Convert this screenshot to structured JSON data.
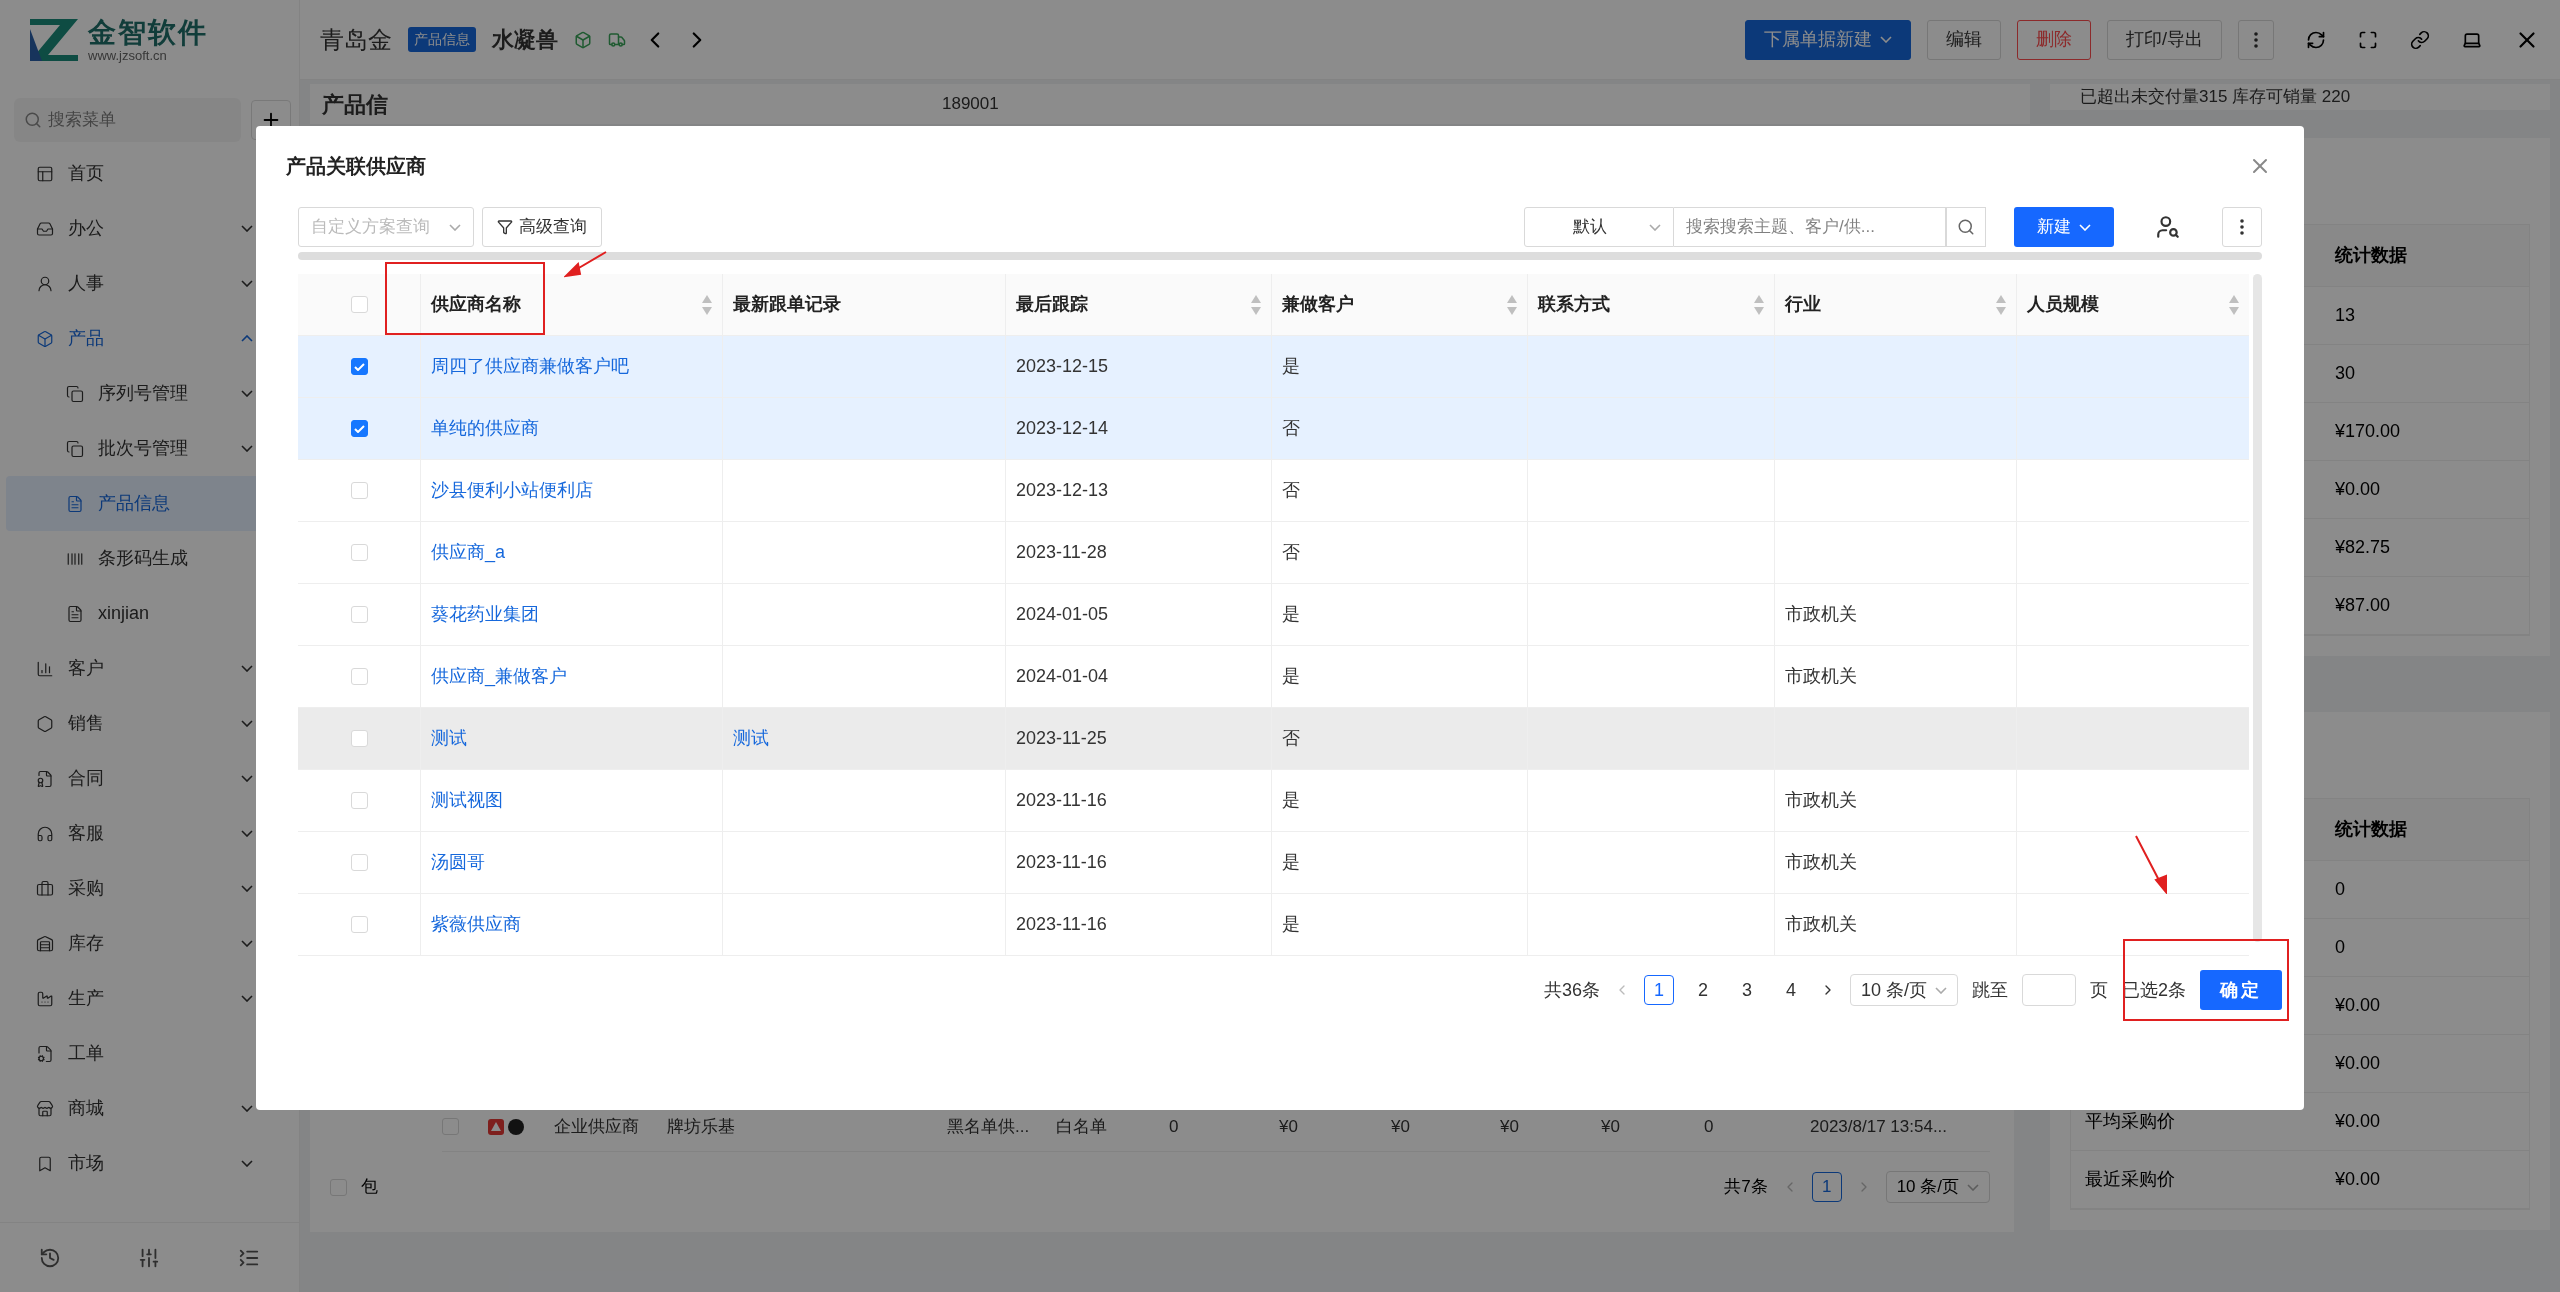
{
  "sidebar": {
    "logo_title": "金智软件",
    "logo_url": "www.jzsoft.cn",
    "search_placeholder": "搜索菜单",
    "items": [
      {
        "label": "首页",
        "kind": "link",
        "selected": false
      },
      {
        "label": "办公",
        "kind": "group",
        "expanded": false,
        "selected": false
      },
      {
        "label": "人事",
        "kind": "group",
        "expanded": false,
        "selected": false
      },
      {
        "label": "产品",
        "kind": "group",
        "expanded": true,
        "selected": false,
        "active": true,
        "children": [
          {
            "label": "序列号管理",
            "kind": "group",
            "expanded": false,
            "selected": false
          },
          {
            "label": "批次号管理",
            "kind": "group",
            "expanded": false,
            "selected": false
          },
          {
            "label": "产品信息",
            "kind": "link",
            "selected": true
          },
          {
            "label": "条形码生成",
            "kind": "link",
            "selected": false
          },
          {
            "label": "xinjian",
            "kind": "link",
            "selected": false
          }
        ]
      },
      {
        "label": "客户",
        "kind": "group",
        "expanded": false,
        "selected": false
      },
      {
        "label": "销售",
        "kind": "group",
        "expanded": false,
        "selected": false
      },
      {
        "label": "合同",
        "kind": "group",
        "expanded": false,
        "selected": false
      },
      {
        "label": "客服",
        "kind": "group",
        "expanded": false,
        "selected": false
      },
      {
        "label": "采购",
        "kind": "group",
        "expanded": false,
        "selected": false
      },
      {
        "label": "库存",
        "kind": "group",
        "expanded": false,
        "selected": false
      },
      {
        "label": "生产",
        "kind": "group",
        "expanded": false,
        "selected": false
      },
      {
        "label": "工单",
        "kind": "link",
        "selected": false
      },
      {
        "label": "商城",
        "kind": "group",
        "expanded": false,
        "selected": false
      },
      {
        "label": "市场",
        "kind": "group",
        "expanded": false,
        "selected": false
      }
    ]
  },
  "header": {
    "breadcrumb": "青岛金",
    "tag": "产品信息",
    "title": "水凝兽",
    "buttons": [
      {
        "label": "下属单据新建",
        "kind": "primary"
      },
      {
        "label": "编辑",
        "kind": "default"
      },
      {
        "label": "删除",
        "kind": "danger"
      },
      {
        "label": "打印/导出",
        "kind": "default"
      }
    ]
  },
  "main": {
    "section_title": "产品信",
    "field_value": "189001",
    "bottom_row": {
      "checked": false,
      "cells": [
        "企业供应商",
        "牌坊乐基",
        "黑名单供...",
        "白名单",
        "0",
        "¥0",
        "¥0",
        "¥0",
        "¥0",
        "0",
        "2023/8/17 13:54..."
      ]
    },
    "pagination": {
      "total": "共7条",
      "pages": [
        {
          "label": "1",
          "selected": true
        }
      ],
      "page_size": "10 条/页"
    },
    "include_option": {
      "label": "包",
      "checked": false
    }
  },
  "right_panel": {
    "note": "已超出未交付量315 库存可销量 220",
    "cards": [
      {
        "header": "统计数据",
        "rows": [
          {
            "value": "13"
          },
          {
            "value": "30"
          },
          {
            "value": "¥170.00"
          },
          {
            "value": "¥0.00"
          },
          {
            "value": "¥82.75"
          },
          {
            "value": "¥87.00"
          }
        ]
      },
      {
        "header": "统计数据",
        "rows": [
          {
            "value": "0"
          },
          {
            "value": "0"
          },
          {
            "value": "¥0.00"
          },
          {
            "value": "¥0.00"
          },
          {
            "label": "平均采购价",
            "value": "¥0.00"
          },
          {
            "label": "最近采购价",
            "value": "¥0.00"
          }
        ]
      }
    ]
  },
  "dialog": {
    "title": "产品关联供应商",
    "toolbar": {
      "scheme_placeholder": "自定义方案查询",
      "advanced": "高级查询",
      "view": "默认",
      "search_placeholder": "搜索搜索主题、客户/供...",
      "new": "新建"
    },
    "select_all_checked": false,
    "columns": [
      {
        "label": "供应商名称",
        "sortable": true
      },
      {
        "label": "最新跟单记录",
        "sortable": false
      },
      {
        "label": "最后跟踪",
        "sortable": true
      },
      {
        "label": "兼做客户",
        "sortable": true
      },
      {
        "label": "联系方式",
        "sortable": true
      },
      {
        "label": "行业",
        "sortable": true
      },
      {
        "label": "人员规模",
        "sortable": true
      }
    ],
    "rows": [
      {
        "selected": true,
        "hovered": false,
        "name": "周四了供应商兼做客户吧",
        "last_tracked": "2023-12-15",
        "also_customer": "是"
      },
      {
        "selected": true,
        "hovered": false,
        "name": "单纯的供应商",
        "last_tracked": "2023-12-14",
        "also_customer": "否"
      },
      {
        "selected": false,
        "hovered": false,
        "name": "沙县便利小站便利店",
        "last_tracked": "2023-12-13",
        "also_customer": "否"
      },
      {
        "selected": false,
        "hovered": false,
        "name": "供应商_a",
        "last_tracked": "2023-11-28",
        "also_customer": "否"
      },
      {
        "selected": false,
        "hovered": false,
        "name": "葵花药业集团",
        "last_tracked": "2024-01-05",
        "also_customer": "是",
        "industry": "市政机关"
      },
      {
        "selected": false,
        "hovered": false,
        "name": "供应商_兼做客户",
        "last_tracked": "2024-01-04",
        "also_customer": "是",
        "industry": "市政机关"
      },
      {
        "selected": false,
        "hovered": true,
        "name": "测试",
        "record": "测试",
        "last_tracked": "2023-11-25",
        "also_customer": "否"
      },
      {
        "selected": false,
        "hovered": false,
        "name": "测试视图",
        "last_tracked": "2023-11-16",
        "also_customer": "是",
        "industry": "市政机关"
      },
      {
        "selected": false,
        "hovered": false,
        "name": "汤圆哥",
        "last_tracked": "2023-11-16",
        "also_customer": "是",
        "industry": "市政机关"
      },
      {
        "selected": false,
        "hovered": false,
        "name": "紫薇供应商",
        "last_tracked": "2023-11-16",
        "also_customer": "是",
        "industry": "市政机关"
      }
    ],
    "pagination": {
      "total": "共36条",
      "pages": [
        {
          "label": "1",
          "selected": true
        },
        {
          "label": "2",
          "selected": false
        },
        {
          "label": "3",
          "selected": false
        },
        {
          "label": "4",
          "selected": false
        }
      ],
      "page_size": "10 条/页",
      "jump_label": "跳至",
      "page_unit": "页",
      "selected_count": "已选2条",
      "confirm": "确定"
    }
  }
}
